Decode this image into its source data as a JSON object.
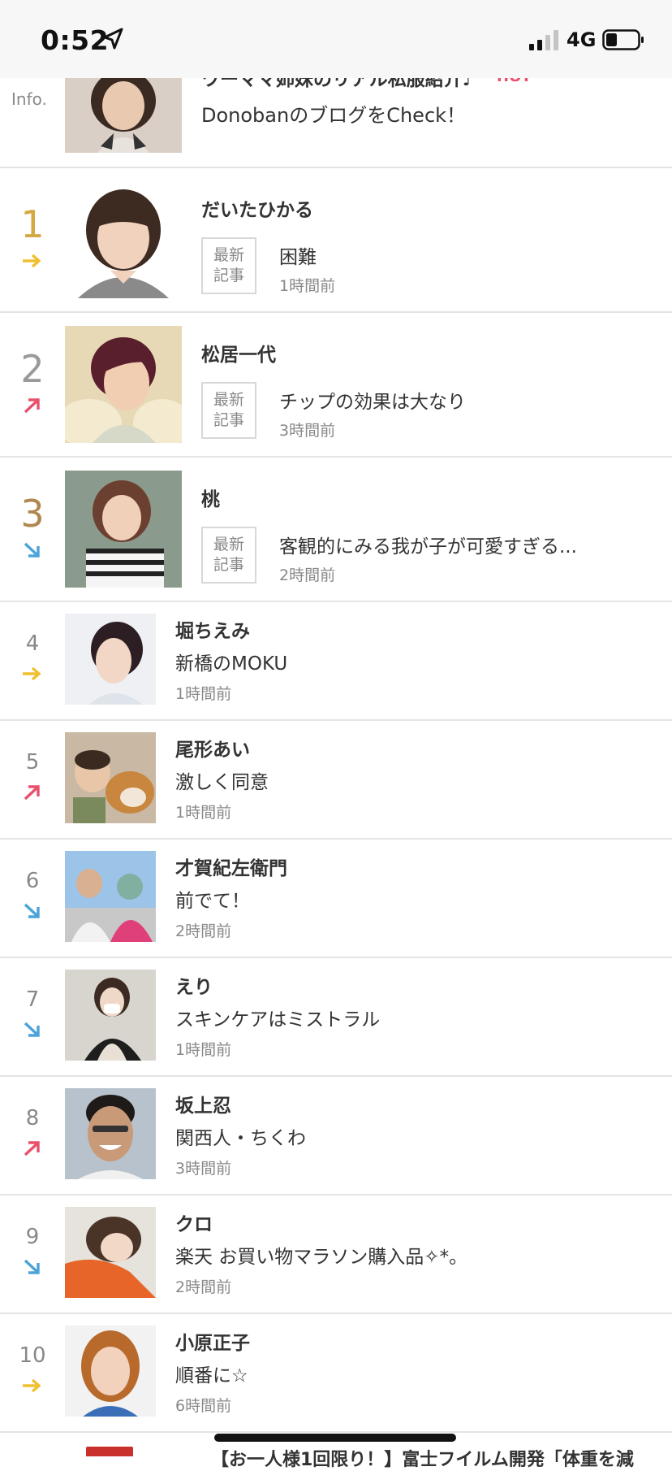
{
  "status_bar": {
    "time": "0:52",
    "network": "4G"
  },
  "info": {
    "label": "Info.",
    "title": "ワーママ姉妹のリアル私服紹介♪",
    "hot_badge": "HOT",
    "subtitle": "DonobanのブログをCheck！"
  },
  "latest_badge": {
    "line1": "最新",
    "line2": "記事"
  },
  "ranking": [
    {
      "rank": "1",
      "trend": "same",
      "name": "だいたひかる",
      "title": "困難",
      "time": "1時間前"
    },
    {
      "rank": "2",
      "trend": "up",
      "name": "松居一代",
      "title": "チップの効果は大なり",
      "time": "3時間前"
    },
    {
      "rank": "3",
      "trend": "down",
      "name": "桃",
      "title": "客観的にみる我が子が可愛すぎる...",
      "time": "2時間前"
    },
    {
      "rank": "4",
      "trend": "same",
      "name": "堀ちえみ",
      "title": "新橋のMOKU",
      "time": "1時間前"
    },
    {
      "rank": "5",
      "trend": "up",
      "name": "尾形あい",
      "title": "激しく同意",
      "time": "1時間前"
    },
    {
      "rank": "6",
      "trend": "down",
      "name": "才賀紀左衛門",
      "title": "前でて！",
      "time": "2時間前"
    },
    {
      "rank": "7",
      "trend": "down",
      "name": "えり",
      "title": "スキンケアはミストラル",
      "time": "1時間前"
    },
    {
      "rank": "8",
      "trend": "up",
      "name": "坂上忍",
      "title": "関西人・ちくわ",
      "time": "3時間前"
    },
    {
      "rank": "9",
      "trend": "down",
      "name": "クロ",
      "title": "楽天 お買い物マラソン購入品✧*。",
      "time": "2時間前"
    },
    {
      "rank": "10",
      "trend": "same",
      "name": "小原正子",
      "title": "順番に☆",
      "time": "6時間前"
    }
  ],
  "bottom_peek": "【お一人様1回限り！】富士フイルム開発「体重を減",
  "colors": {
    "rank1": "#d4a843",
    "rank2": "#9a9a9a",
    "rank3": "#b08750",
    "up": "#e8506c",
    "down": "#4aa3d9",
    "same": "#f0c030"
  }
}
